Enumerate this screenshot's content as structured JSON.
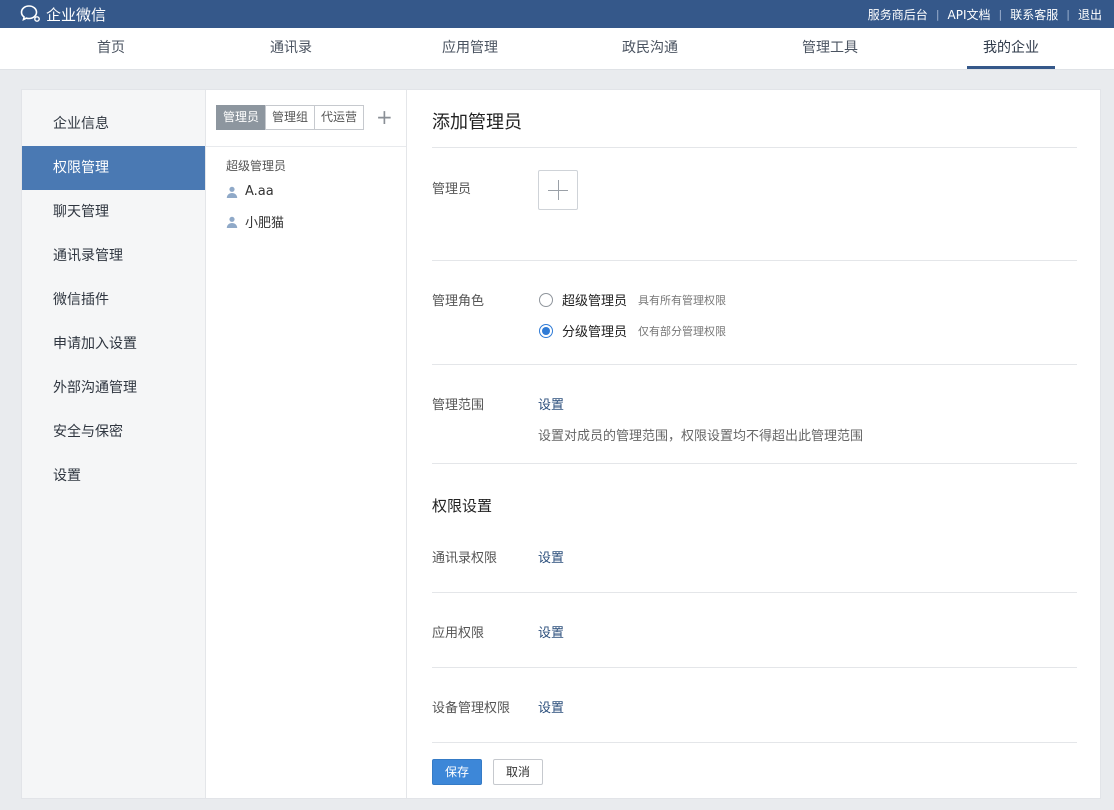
{
  "app": {
    "brand": "企业微信"
  },
  "toplinks": [
    "服务商后台",
    "API文档",
    "联系客服",
    "退出"
  ],
  "nav": {
    "items": [
      "首页",
      "通讯录",
      "应用管理",
      "政民沟通",
      "管理工具",
      "我的企业"
    ],
    "active": "我的企业"
  },
  "sidebar": {
    "items": [
      "企业信息",
      "权限管理",
      "聊天管理",
      "通讯录管理",
      "微信插件",
      "申请加入设置",
      "外部沟通管理",
      "安全与保密",
      "设置"
    ],
    "active": "权限管理"
  },
  "admin_list": {
    "tabs": [
      "管理员",
      "管理组",
      "代运营"
    ],
    "active_tab": "管理员",
    "group_title": "超级管理员",
    "members": [
      "A.aa",
      "小肥猫"
    ]
  },
  "form": {
    "title": "添加管理员",
    "admin_label": "管理员",
    "role_label": "管理角色",
    "roles": [
      {
        "label": "超级管理员",
        "desc": "具有所有管理权限",
        "selected": false
      },
      {
        "label": "分级管理员",
        "desc": "仅有部分管理权限",
        "selected": true
      }
    ],
    "scope_label": "管理范围",
    "scope_link": "设置",
    "scope_hint": "设置对成员的管理范围，权限设置均不得超出此管理范围",
    "perm_title": "权限设置",
    "perms": [
      {
        "label": "通讯录权限",
        "link": "设置"
      },
      {
        "label": "应用权限",
        "link": "设置"
      },
      {
        "label": "设备管理权限",
        "link": "设置"
      }
    ],
    "save": "保存",
    "cancel": "取消"
  },
  "colors": {
    "topbar": "#35588a",
    "sidebar_active": "#4a79b3",
    "primary_button": "#3d87d8",
    "link": "#2c4f7c"
  }
}
